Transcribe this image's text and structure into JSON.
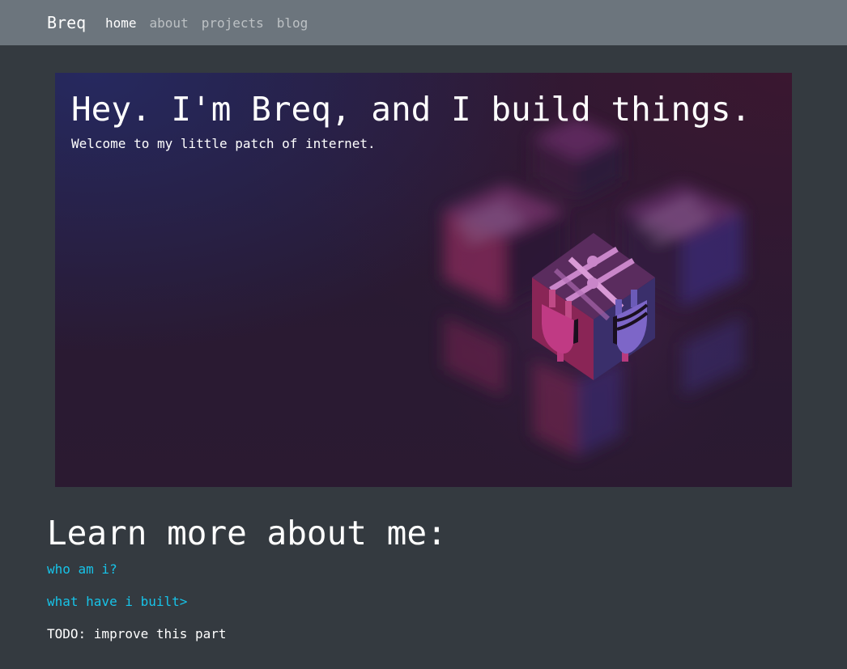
{
  "nav": {
    "brand": "Breq",
    "links": [
      {
        "label": "home",
        "active": true
      },
      {
        "label": "about",
        "active": false
      },
      {
        "label": "projects",
        "active": false
      },
      {
        "label": "blog",
        "active": false
      }
    ]
  },
  "hero": {
    "title": "Hey. I'm Breq, and I build things.",
    "subtitle": "Welcome to my little patch of internet.",
    "image": "isometric-cube-logo-illustration"
  },
  "learn_more": {
    "title": "Learn more about me:",
    "links": [
      {
        "label": "who am i?"
      },
      {
        "label": "what have i built>"
      }
    ],
    "todo": "TODO: improve this part"
  },
  "colors": {
    "navbar": "#6c757d",
    "background": "#343a40",
    "link": "#17c3e8",
    "cube_pink": "#b8397e",
    "cube_purple": "#3a2f6b",
    "cube_top": "#5a2c5e"
  }
}
